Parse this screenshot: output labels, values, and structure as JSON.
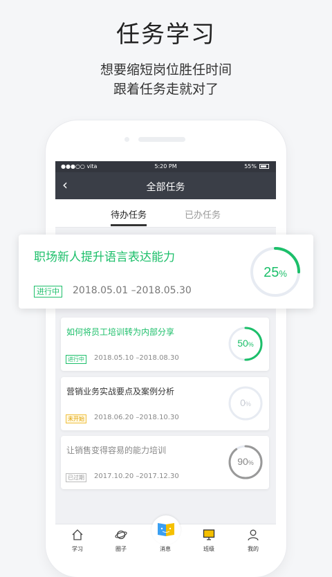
{
  "hero": {
    "title": "任务学习",
    "subtitle_line1": "想要缩短岗位胜任时间",
    "subtitle_line2": "跟着任务走就对了"
  },
  "status_bar": {
    "carrier": "●●●○○ vita",
    "time": "5:20 PM",
    "battery": "55%"
  },
  "nav": {
    "back_icon": "‹",
    "title": "全部任务"
  },
  "tabs": [
    {
      "label": "待办任务",
      "active": true
    },
    {
      "label": "已办任务",
      "active": false
    }
  ],
  "tasks": [
    {
      "title": "职场新人提升语言表达能力",
      "status": "进行中",
      "dates": "2018.05.01 –2018.05.30",
      "progress_label": "25",
      "percent_sign": "%",
      "progress": 0.25,
      "color": "#1cbf6a"
    },
    {
      "title": "如何将员工培训转为内部分享",
      "status": "进行中",
      "dates": "2018.05.10 –2018.08.30",
      "progress_label": "50",
      "percent_sign": "%",
      "progress": 0.5,
      "color": "#1cbf6a"
    },
    {
      "title": "营销业务实战要点及案例分析",
      "status": "未开始",
      "dates": "2018.06.20 –2018.10.30",
      "progress_label": "0",
      "percent_sign": "%",
      "progress": 0,
      "color": "#f0b000"
    },
    {
      "title": "让销售变得容易的能力培训",
      "status": "已过期",
      "dates": "2017.10.20 –2017.12.30",
      "progress_label": "90",
      "percent_sign": "%",
      "progress": 0.9,
      "color": "#999999"
    }
  ],
  "bottom_nav": [
    {
      "label": "学习",
      "icon": "home-icon"
    },
    {
      "label": "圈子",
      "icon": "planet-icon"
    },
    {
      "label": "消息",
      "icon": "book-icon"
    },
    {
      "label": "班级",
      "icon": "monitor-icon"
    },
    {
      "label": "我的",
      "icon": "person-icon"
    }
  ]
}
